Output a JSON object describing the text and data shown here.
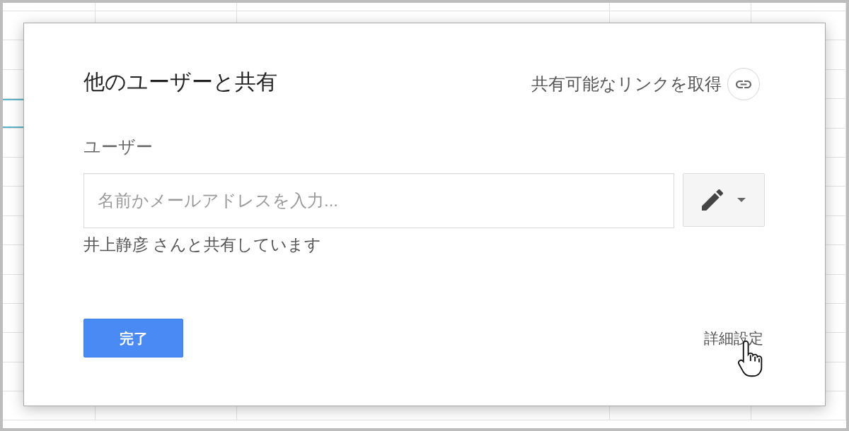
{
  "dialog": {
    "title": "他のユーザーと共有",
    "get_link": {
      "label": "共有可能なリンクを取得"
    },
    "users_label": "ユーザー",
    "invite_field": {
      "placeholder": "名前かメールアドレスを入力..."
    },
    "shared_note": "井上静彦 さんと共有しています",
    "done_button": "完了",
    "advanced_link": "詳細設定"
  }
}
